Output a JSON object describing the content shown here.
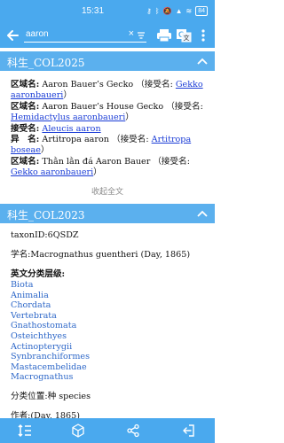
{
  "status_bar": {
    "time": "15:31",
    "battery": "84"
  },
  "toolbar": {
    "search_value": "aaron"
  },
  "sections": [
    {
      "title": "科生_COL2025",
      "rows": [
        {
          "label": "区域名:",
          "text": "Aaron Bauer’s Gecko  （接受名:",
          "link": "Gekko aaronbaueri",
          "tail": "）"
        },
        {
          "label": "区域名:",
          "text": "Aaron Bauer’s House Gecko  （接受名:",
          "link": "Hemidactylus aaronbaueri",
          "tail": "）"
        },
        {
          "label": "接受名:",
          "text": "",
          "link": "Aleucis aaron",
          "tail": ""
        },
        {
          "label": "异　名:",
          "text": "Artitropa aaron  （接受名:",
          "link": "Artitropa boseae",
          "tail": "）"
        },
        {
          "label": "区域名:",
          "text": "Thằn lằn đá Aaron Bauer  （接受名:",
          "link": "Gekko aaronbaueri",
          "tail": "）"
        }
      ],
      "collapse_label": "收起全文"
    },
    {
      "title": "科生_COL2023",
      "taxon_id": "taxonID:6QSDZ",
      "scientific_name": "学名:Macrognathus guentheri (Day, 1865)",
      "classification_heading": "英文分类层级:",
      "classification": [
        "Biota",
        "Animalia",
        "Chordata",
        "Vertebrata",
        "Gnathostomata",
        "Osteichthyes",
        "Actinopterygii",
        "Synbranchiformes",
        "Mastacembelidae",
        "Macrognathus"
      ],
      "rank": "分类位置:种 species",
      "author": "作者:(Day, 1865)"
    }
  ],
  "colors": {
    "bar": "#4aa9ee",
    "header": "#5bb0ee",
    "link": "#1a3cd6",
    "taxon": "#2d67c8"
  }
}
